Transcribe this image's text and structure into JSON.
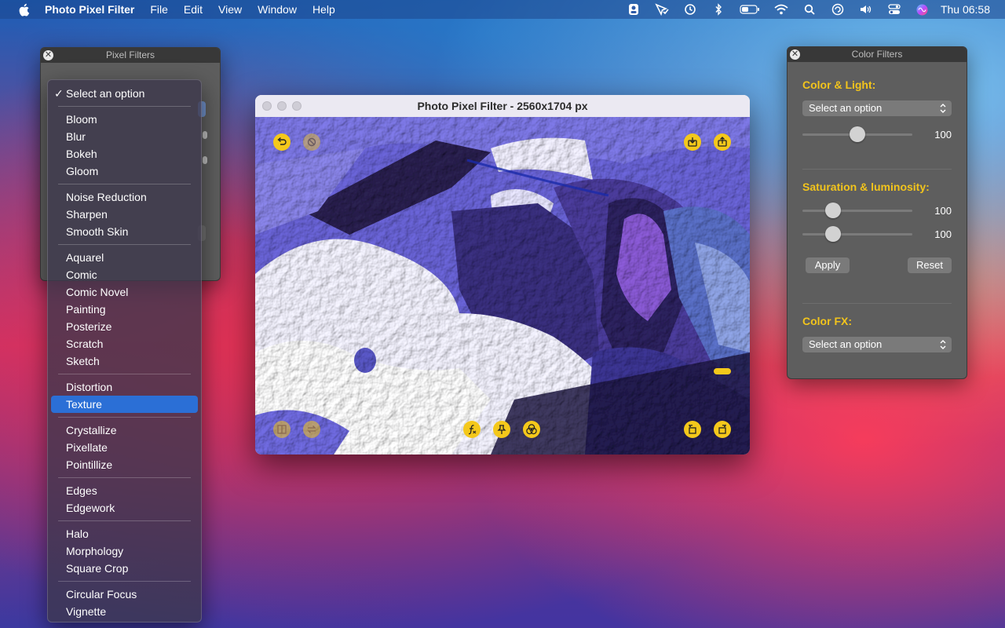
{
  "menubar": {
    "app_name": "Photo Pixel Filter",
    "menus": [
      "File",
      "Edit",
      "View",
      "Window",
      "Help"
    ],
    "clock": "Thu 06:58"
  },
  "pixel_panel": {
    "title": "Pixel Filters"
  },
  "dropdown": {
    "selected": "Select an option",
    "highlighted": "Texture",
    "groups": [
      [
        "Bloom",
        "Blur",
        "Bokeh",
        "Gloom"
      ],
      [
        "Noise Reduction",
        "Sharpen",
        "Smooth Skin"
      ],
      [
        "Aquarel",
        "Comic",
        "Comic Novel",
        "Painting",
        "Posterize",
        "Scratch",
        "Sketch"
      ],
      [
        "Distortion",
        "Texture"
      ],
      [
        "Crystallize",
        "Pixellate",
        "Pointillize"
      ],
      [
        "Edges",
        "Edgework"
      ],
      [
        "Halo",
        "Morphology",
        "Square Crop"
      ],
      [
        "Circular Focus",
        "Vignette"
      ]
    ]
  },
  "main_window": {
    "title": "Photo Pixel Filter - 2560x1704 px"
  },
  "color_panel": {
    "title": "Color Filters",
    "color_light": {
      "label": "Color & Light:",
      "select": "Select an option",
      "slider_value": "100",
      "slider_position": 0.5
    },
    "saturation": {
      "label": "Saturation & luminosity:",
      "slider1_value": "100",
      "slider1_position": 0.28,
      "slider2_value": "100",
      "slider2_position": 0.28
    },
    "apply_label": "Apply",
    "reset_label": "Reset",
    "color_fx": {
      "label": "Color FX:",
      "select": "Select an option"
    }
  },
  "colors": {
    "accent_yellow": "#f4c81b",
    "highlight_blue": "#2b6fd6"
  }
}
